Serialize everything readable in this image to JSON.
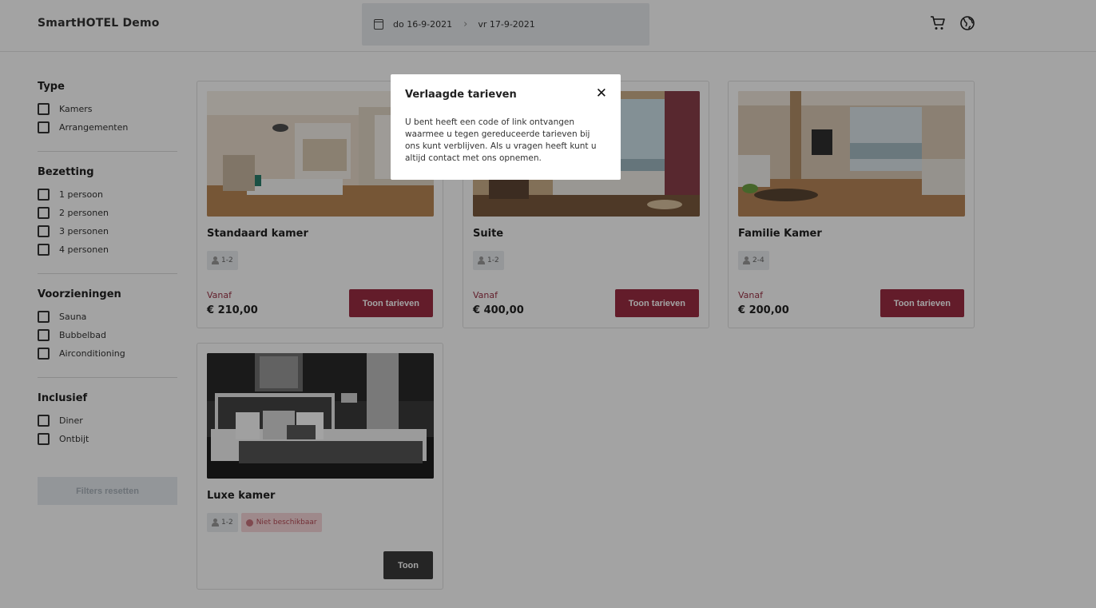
{
  "header": {
    "brand": "SmartHOTEL Demo",
    "date_from": "do 16-9-2021",
    "date_to": "vr 17-9-2021",
    "icons": [
      "calendar-icon",
      "chevron-right-icon",
      "cart-icon",
      "globe-icon"
    ]
  },
  "filters": {
    "groups": [
      {
        "title": "Type",
        "options": [
          "Kamers",
          "Arrangementen"
        ]
      },
      {
        "title": "Bezetting",
        "options": [
          "1 persoon",
          "2 personen",
          "3 personen",
          "4 personen"
        ]
      },
      {
        "title": "Voorzieningen",
        "options": [
          "Sauna",
          "Bubbelbad",
          "Airconditioning"
        ]
      },
      {
        "title": "Inclusief",
        "options": [
          "Diner",
          "Ontbijt"
        ]
      }
    ],
    "reset_label": "Filters resetten"
  },
  "rooms": [
    {
      "name": "Standaard kamer",
      "occupancy": "1-2",
      "from_label": "Vanaf",
      "price": "€ 210,00",
      "button": "Toon tarieven"
    },
    {
      "name": "Suite",
      "occupancy": "1-2",
      "from_label": "Vanaf",
      "price": "€ 400,00",
      "button": "Toon tarieven"
    },
    {
      "name": "Familie Kamer",
      "occupancy": "2-4",
      "from_label": "Vanaf",
      "price": "€ 200,00",
      "button": "Toon tarieven"
    },
    {
      "name": "Luxe kamer",
      "occupancy": "1-2",
      "unavailable": "Niet beschikbaar",
      "button": "Toon"
    }
  ],
  "modal": {
    "title": "Verlaagde tarieven",
    "close": "✕",
    "body": "U bent heeft een code of link ontvangen waarmee u tegen gereduceerde tarieven bij ons kunt verblijven. Als u vragen heeft kunt u altijd contact met ons opnemen."
  },
  "colors": {
    "accent": "#9b2c43",
    "overlay": "rgba(0,0,0,0.36)",
    "unavailable": "#f8d7da"
  }
}
